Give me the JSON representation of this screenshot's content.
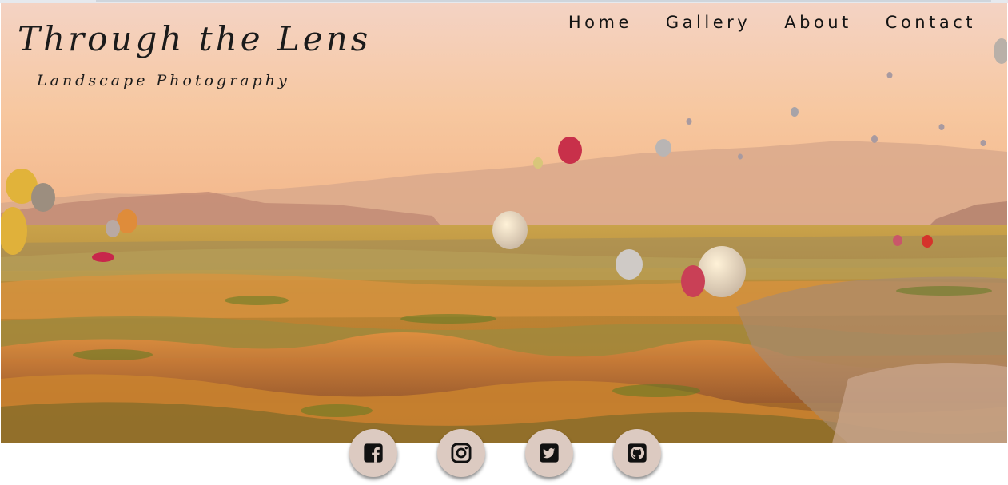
{
  "brand": {
    "title": "Through the Lens",
    "subtitle": "Landscape Photography"
  },
  "nav": {
    "items": [
      "Home",
      "Gallery",
      "About",
      "Contact"
    ]
  },
  "hero": {
    "image": "hot-air-balloons-over-valley-landscape"
  },
  "social": {
    "icons": [
      "facebook-icon",
      "instagram-icon",
      "twitter-icon",
      "github-icon"
    ]
  }
}
